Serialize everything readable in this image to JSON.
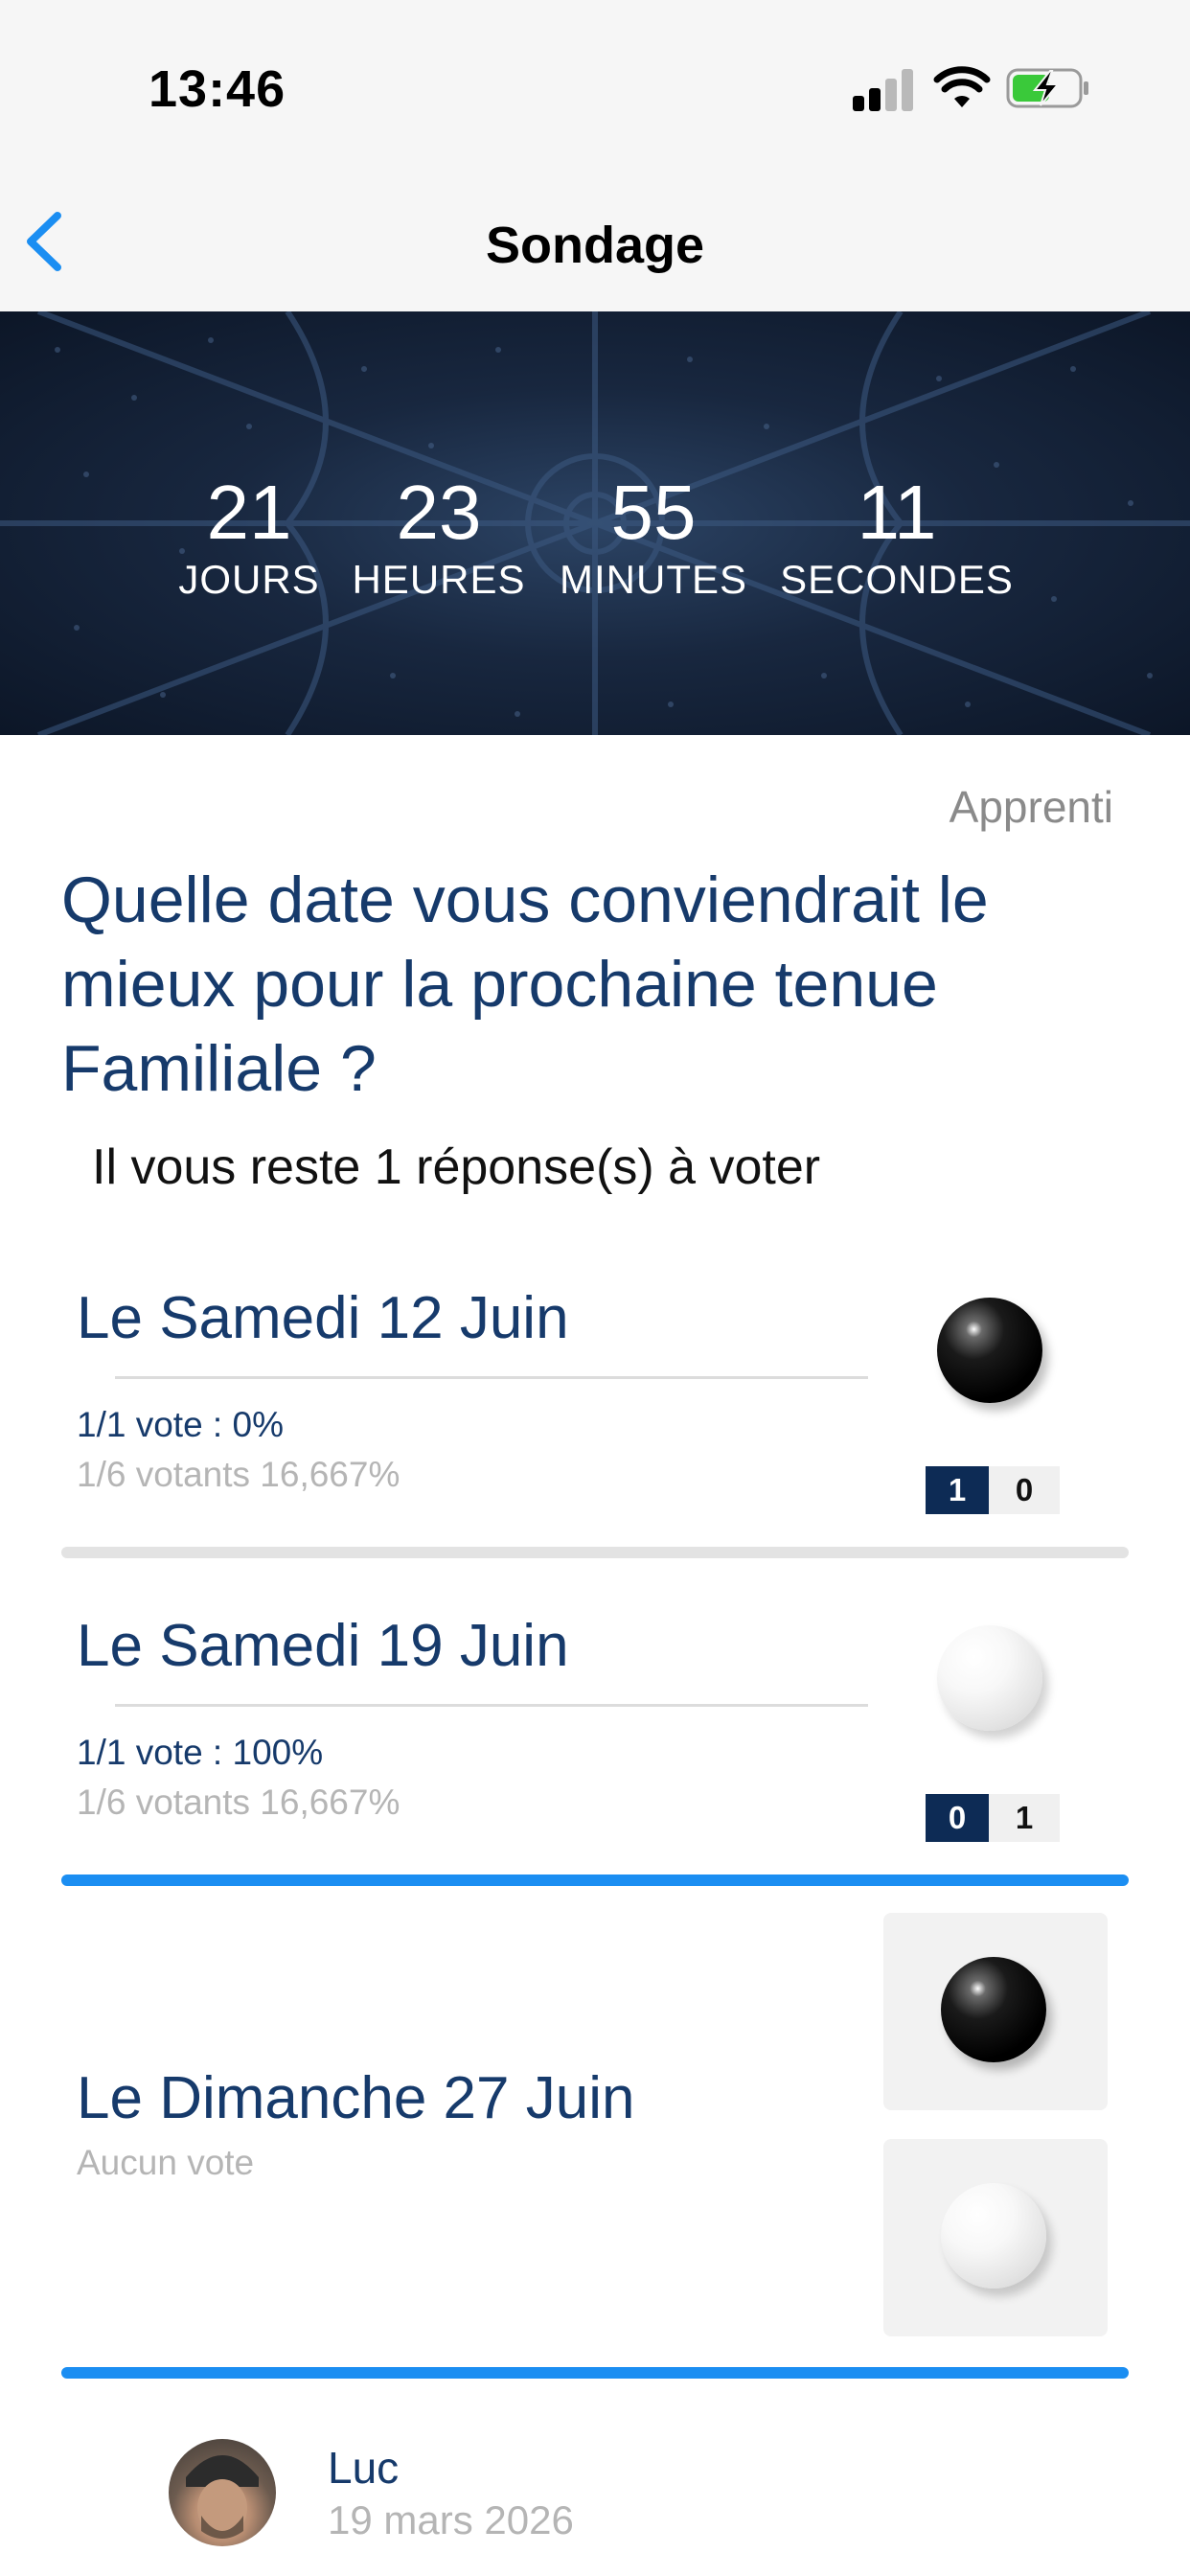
{
  "status_bar": {
    "time": "13:46"
  },
  "nav": {
    "title": "Sondage"
  },
  "countdown": {
    "days": {
      "value": "21",
      "label": "JOURS"
    },
    "hours": {
      "value": "23",
      "label": "HEURES"
    },
    "minutes": {
      "value": "55",
      "label": "MINUTES"
    },
    "seconds": {
      "value": "11",
      "label": "SECONDES"
    }
  },
  "poll": {
    "role": "Apprenti",
    "question": "Quelle date vous conviendrait le mieux pour la prochaine tenue Familiale ?",
    "remaining": "Il vous reste 1 réponse(s) à voter",
    "options": [
      {
        "title": "Le Samedi 12 Juin",
        "vote": "1/1 vote : 0%",
        "voters": "1/6 votants 16,667%",
        "black_count": "1",
        "white_count": "0",
        "selected_ball": "black"
      },
      {
        "title": "Le Samedi 19 Juin",
        "vote": "1/1 vote : 100%",
        "voters": "1/6 votants 16,667%",
        "black_count": "0",
        "white_count": "1",
        "selected_ball": "white"
      },
      {
        "title": "Le Dimanche 27 Juin",
        "no_vote": "Aucun vote"
      }
    ]
  },
  "author": {
    "name": "Luc",
    "date": "19 mars 2026"
  },
  "colors": {
    "accent": "#1b8ef2",
    "navy": "#163a6b",
    "score_dark": "#0d2b55"
  }
}
